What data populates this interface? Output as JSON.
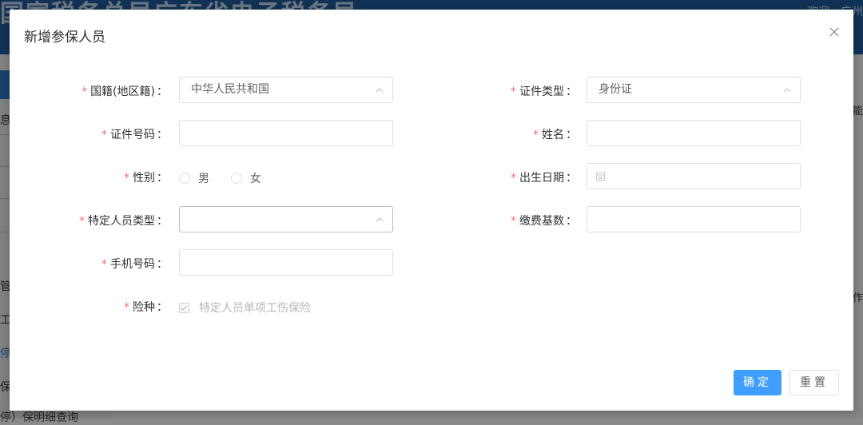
{
  "background": {
    "header_title": "国家税务总局广东省电子税务局",
    "header_welcome": "欢迎，广州",
    "sidebar_fragments": [
      "息",
      "管",
      "工",
      "停",
      "保",
      "停）保明细查询"
    ],
    "right_fragments": [
      "能",
      "作"
    ]
  },
  "dialog": {
    "title": "新增参保人员",
    "required_mark": "*",
    "colon": "：",
    "fields": {
      "nationality": {
        "label": "国籍(地区籍)",
        "value": "中华人民共和国"
      },
      "id_type": {
        "label": "证件类型",
        "value": "身份证"
      },
      "id_number": {
        "label": "证件号码",
        "value": ""
      },
      "name": {
        "label": "姓名",
        "value": ""
      },
      "gender": {
        "label": "性别",
        "options": [
          "男",
          "女"
        ]
      },
      "birth_date": {
        "label": "出生日期",
        "value": ""
      },
      "person_type": {
        "label": "特定人员类型",
        "value": ""
      },
      "pay_base": {
        "label": "缴费基数",
        "value": ""
      },
      "phone": {
        "label": "手机号码",
        "value": ""
      },
      "insurance_type": {
        "label": "险种",
        "option": "特定人员单项工伤保险",
        "checked": true,
        "disabled": true
      }
    },
    "buttons": {
      "confirm": "确定",
      "reset": "重置"
    },
    "icons": {
      "close": "close-icon",
      "chevron": "chevron-up-icon",
      "calendar": "calendar-icon"
    },
    "colors": {
      "primary": "#409eff",
      "required": "#f56c6c",
      "border": "#dcdfe6"
    }
  }
}
